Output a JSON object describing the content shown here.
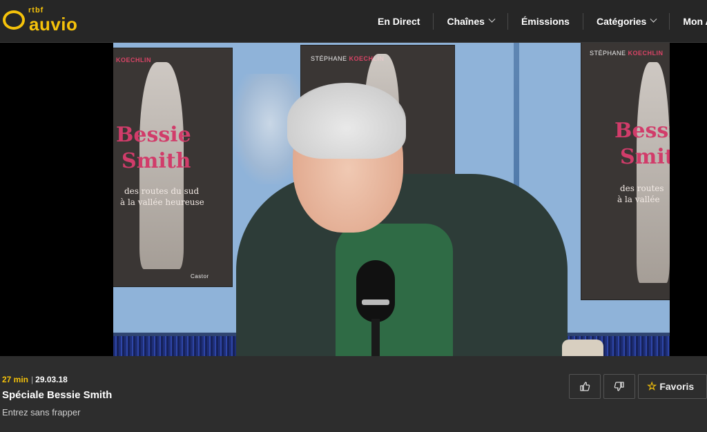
{
  "brand": {
    "small": "rtbf",
    "name": "auvio",
    "accent": "#f5c20a"
  },
  "nav": {
    "items": [
      {
        "label": "En Direct",
        "dropdown": false
      },
      {
        "label": "Chaînes",
        "dropdown": true
      },
      {
        "label": "Émissions",
        "dropdown": false
      },
      {
        "label": "Catégories",
        "dropdown": true
      },
      {
        "label": "Mon A",
        "dropdown": false
      }
    ]
  },
  "video": {
    "poster": {
      "author_first": "STÉPHANE",
      "author_last": "KOECHLIN",
      "title_line1": "Bessie",
      "title_line2": "Smith",
      "subtitle_line1": "des routes du sud",
      "subtitle_line2": "à la vallée heureuse",
      "subtitle_line2_cropped": "à la vallée",
      "subtitle_line1_cropped": "des routes",
      "publisher": "Castor"
    }
  },
  "info": {
    "duration": "27 min",
    "separator": "|",
    "date": "29.03.18",
    "title": "Spéciale Bessie Smith",
    "subtitle": "Entrez sans frapper"
  },
  "actions": {
    "like_icon": "thumbs-up-icon",
    "dislike_icon": "thumbs-down-icon",
    "favorite_label": "Favoris",
    "favorite_icon": "star-icon"
  }
}
